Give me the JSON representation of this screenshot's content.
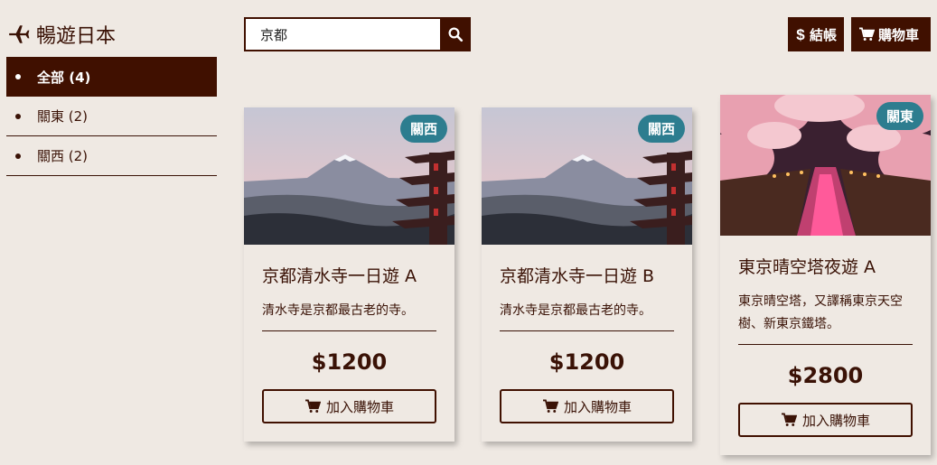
{
  "brand": {
    "title": "暢遊日本",
    "icon": "plane-icon"
  },
  "sidebar": {
    "items": [
      {
        "label": "全部 (4)",
        "active": true
      },
      {
        "label": "關東 (2)",
        "active": false
      },
      {
        "label": "關西 (2)",
        "active": false
      }
    ]
  },
  "search": {
    "value": "京都",
    "icon": "search-icon"
  },
  "toolbar": {
    "checkout_label": "結帳",
    "cart_label": "購物車"
  },
  "products": [
    {
      "badge": "關西",
      "title": "京都清水寺一日遊 A",
      "desc": "清水寺是京都最古老的寺。",
      "price": "$1200",
      "button": "加入購物車"
    },
    {
      "badge": "關西",
      "title": "京都清水寺一日遊 B",
      "desc": "清水寺是京都最古老的寺。",
      "price": "$1200",
      "button": "加入購物車"
    },
    {
      "badge": "關東",
      "title": "東京晴空塔夜遊 A",
      "desc": "東京晴空塔，又譯稱東京天空樹、新東京鐵塔。",
      "price": "$2800",
      "button": "加入購物車"
    }
  ],
  "colors": {
    "primary": "#401000",
    "background": "#efe9e3",
    "badge": "#2d7d8f"
  }
}
